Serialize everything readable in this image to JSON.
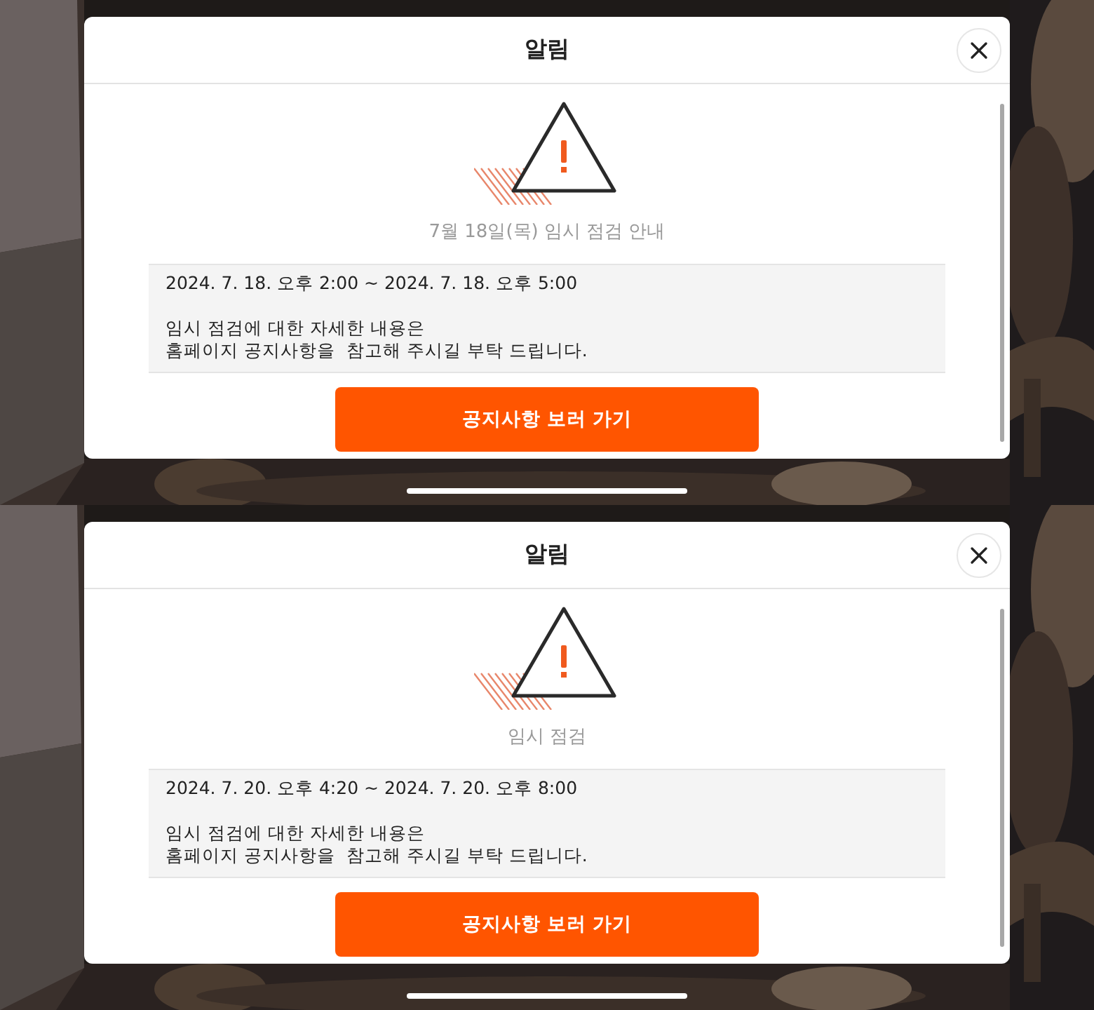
{
  "screens": [
    {
      "dialog": {
        "title": "알림",
        "subtitle": "7월 18일(목) 임시 점검 안내",
        "period": "2024. 7. 18. 오후 2:00 ~ 2024. 7. 18. 오후 5:00",
        "details": [
          "임시 점검에 대한 자세한 내용은",
          "홈페이지 공지사항을  참고해 주시길 부탁 드립니다."
        ],
        "button": "공지사항 보러 가기"
      }
    },
    {
      "dialog": {
        "title": "알림",
        "subtitle": "임시 점검",
        "period": "2024. 7. 20. 오후 4:20 ~ 2024. 7. 20. 오후 8:00",
        "details": [
          "임시 점검에 대한 자세한 내용은",
          "홈페이지 공지사항을  참고해 주시길 부탁 드립니다."
        ],
        "button": "공지사항 보러 가기"
      }
    }
  ]
}
